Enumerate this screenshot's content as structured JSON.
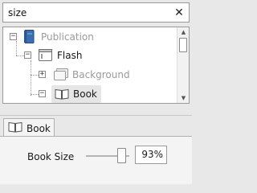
{
  "search": {
    "value": "size"
  },
  "tree": {
    "items": [
      {
        "label": "Publication",
        "muted": true,
        "icon": "publication-book-icon",
        "expander": "−"
      },
      {
        "label": "Flash",
        "muted": false,
        "icon": "flash-window-icon",
        "expander": "−"
      },
      {
        "label": "Background",
        "muted": true,
        "icon": "background-icon",
        "expander": "+"
      },
      {
        "label": "Book",
        "muted": false,
        "icon": "open-book-icon",
        "expander": "−",
        "selected": true
      }
    ]
  },
  "tab": {
    "label": "Book",
    "icon": "open-book-icon"
  },
  "properties": {
    "book_size": {
      "label": "Book Size",
      "value": "93%",
      "level_percent": 93
    }
  }
}
